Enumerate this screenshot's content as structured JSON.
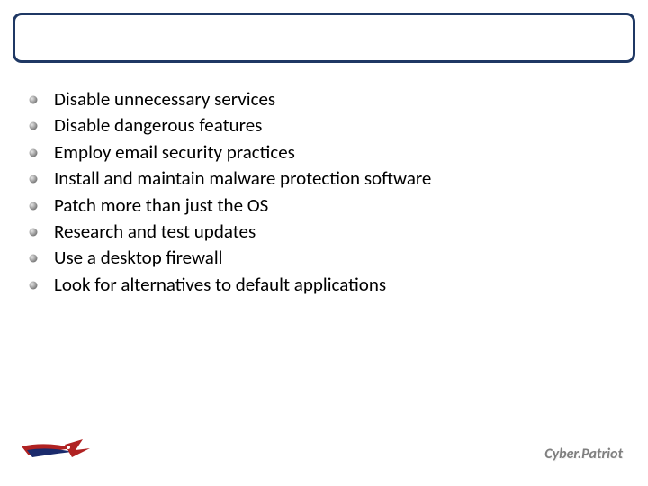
{
  "title": "",
  "bullets": [
    "Disable unnecessary services",
    "Disable dangerous features",
    "Employ email security practices",
    "Install and maintain malware protection software",
    "Patch more than just the OS",
    "Research and test updates",
    "Use a desktop firewall",
    "Look for alternatives to default applications"
  ],
  "footer": {
    "brand": "Cyber.Patriot"
  }
}
